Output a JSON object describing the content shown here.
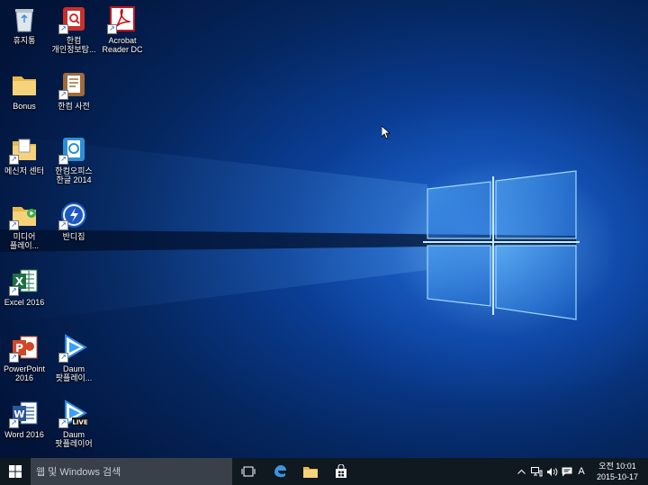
{
  "desktop_icons": [
    {
      "label": "휴지통"
    },
    {
      "label": "한컴\n개인정보탐..."
    },
    {
      "label": "Acrobat\nReader DC"
    },
    {
      "label": "Bonus"
    },
    {
      "label": "한컴 사전"
    },
    {
      "label": "메신저 센터"
    },
    {
      "label": "한컴오피스\n한글 2014"
    },
    {
      "label": "미디어\n플레이..."
    },
    {
      "label": "반디집"
    },
    {
      "label": "Excel 2016"
    },
    {
      "label": "PowerPoint\n2016"
    },
    {
      "label": "Daum\n팟플레이..."
    },
    {
      "label": "Word 2016"
    },
    {
      "label": "Daum\n팟플레이어"
    }
  ],
  "taskbar": {
    "search_placeholder": "웹 및 Windows 검색",
    "ime_indicator": "A",
    "clock": {
      "time": "오전 10:01",
      "date": "2015-10-17"
    }
  },
  "colors": {
    "taskbar": "#101820",
    "search_box": "#39404a",
    "wallpaper_accent": "#1a62c4"
  }
}
